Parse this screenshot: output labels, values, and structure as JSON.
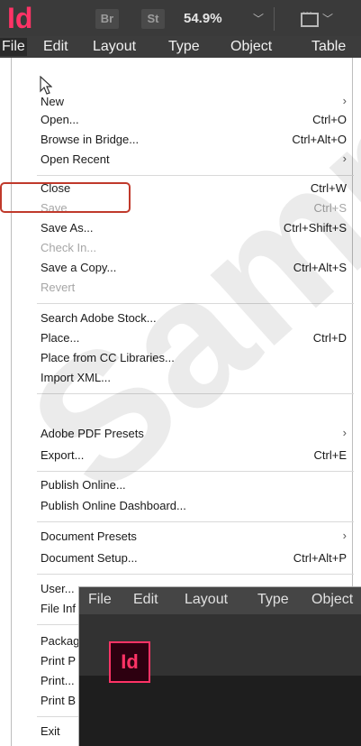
{
  "appbar": {
    "logo": "Id",
    "bridge_label": "Br",
    "stock_label": "St",
    "zoom": "54.9%",
    "zoom_chevron": "﹀",
    "screen_mode_chevron": "﹀"
  },
  "menubar": {
    "items": [
      "File",
      "Edit",
      "Layout",
      "Type",
      "Object",
      "Table"
    ]
  },
  "menu": {
    "new": {
      "label": "New",
      "arrow": "›"
    },
    "open": {
      "label": "Open...",
      "shortcut": "Ctrl+O"
    },
    "browse": {
      "label": "Browse in Bridge...",
      "shortcut": "Ctrl+Alt+O"
    },
    "open_recent": {
      "label": "Open Recent",
      "arrow": "›"
    },
    "close": {
      "label": "Close",
      "shortcut": "Ctrl+W"
    },
    "save": {
      "label": "Save",
      "shortcut": "Ctrl+S"
    },
    "save_as": {
      "label": "Save As...",
      "shortcut": "Ctrl+Shift+S"
    },
    "check_in": {
      "label": "Check In..."
    },
    "save_copy": {
      "label": "Save a Copy...",
      "shortcut": "Ctrl+Alt+S"
    },
    "revert": {
      "label": "Revert"
    },
    "search_stock": {
      "label": "Search Adobe Stock..."
    },
    "place": {
      "label": "Place...",
      "shortcut": "Ctrl+D"
    },
    "place_cc": {
      "label": "Place from CC Libraries..."
    },
    "import_xml": {
      "label": "Import XML..."
    },
    "pdf_presets": {
      "label": "Adobe PDF Presets",
      "arrow": "›"
    },
    "export": {
      "label": "Export...",
      "shortcut": "Ctrl+E"
    },
    "publish_online": {
      "label": "Publish Online..."
    },
    "publish_dashboard": {
      "label": "Publish Online Dashboard..."
    },
    "doc_presets": {
      "label": "Document Presets",
      "arrow": "›"
    },
    "doc_setup": {
      "label": "Document Setup...",
      "shortcut": "Ctrl+Alt+P"
    },
    "user": {
      "label": "User..."
    },
    "file_info": {
      "label": "File Inf"
    },
    "package": {
      "label": "Packag"
    },
    "print_presets": {
      "label": "Print P"
    },
    "print": {
      "label": "Print..."
    },
    "print_booklet": {
      "label": "Print B"
    },
    "exit": {
      "label": "Exit"
    }
  },
  "inset": {
    "menubar": [
      "File",
      "Edit",
      "Layout",
      "Type",
      "Object"
    ],
    "logo": "Id"
  },
  "watermark": "Sample",
  "colors": {
    "accent": "#ff3366",
    "highlight": "#c0392b",
    "appbar": "#3a3a3a"
  }
}
